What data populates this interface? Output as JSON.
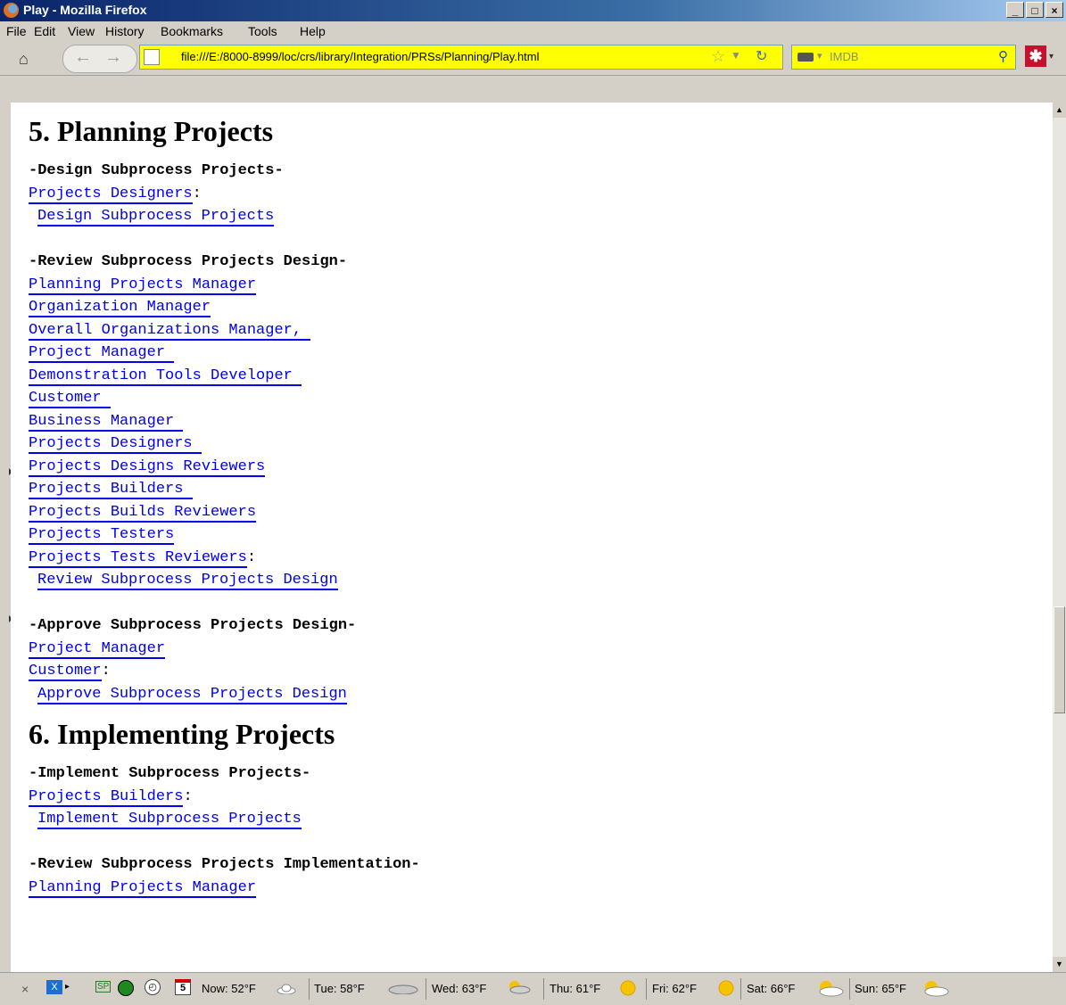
{
  "window": {
    "title": "Play - Mozilla Firefox"
  },
  "menu": [
    "File",
    "Edit",
    "View",
    "History",
    "Bookmarks",
    "Tools",
    "Help"
  ],
  "nav": {
    "url": "file:///E:/8000-8999/loc/crs/library/Integration/PRSs/Planning/Play.html",
    "search_placeholder": "IMDB"
  },
  "content": {
    "section5": {
      "title": "5. Planning Projects",
      "design_heading": "-Design Subprocess Projects-",
      "design_role": "Projects Designers",
      "design_action": "Design Subprocess Projects",
      "review_heading": "-Review Subprocess Projects Design-",
      "review_roles": [
        "Planning Projects Manager",
        "Organization Manager",
        "Overall Organizations Manager, ",
        "Project Manager ",
        "Demonstration Tools Developer ",
        "Customer ",
        "Business Manager ",
        "Projects Designers ",
        "Projects Designs Reviewers",
        "Projects Builders ",
        "Projects Builds Reviewers",
        "Projects Testers",
        "Projects Tests Reviewers"
      ],
      "review_action": "Review Subprocess Projects Design",
      "approve_heading": "-Approve Subprocess Projects Design-",
      "approve_roles": [
        "Project Manager",
        "Customer"
      ],
      "approve_action": "Approve Subprocess Projects Design"
    },
    "section6": {
      "title": "6. Implementing Projects",
      "implement_heading": "-Implement Subprocess Projects-",
      "implement_role": "Projects Builders",
      "implement_action": "Implement Subprocess Projects",
      "review_heading": "-Review Subprocess Projects Implementation-",
      "review_first_role": "Planning Projects Manager"
    }
  },
  "status": {
    "sp": "SP",
    "calendar_day": "5",
    "weather": [
      "Now: 52°F",
      "Tue: 58°F",
      "Wed: 63°F",
      "Thu: 61°F",
      "Fri: 62°F",
      "Sat: 66°F",
      "Sun: 65°F"
    ]
  }
}
